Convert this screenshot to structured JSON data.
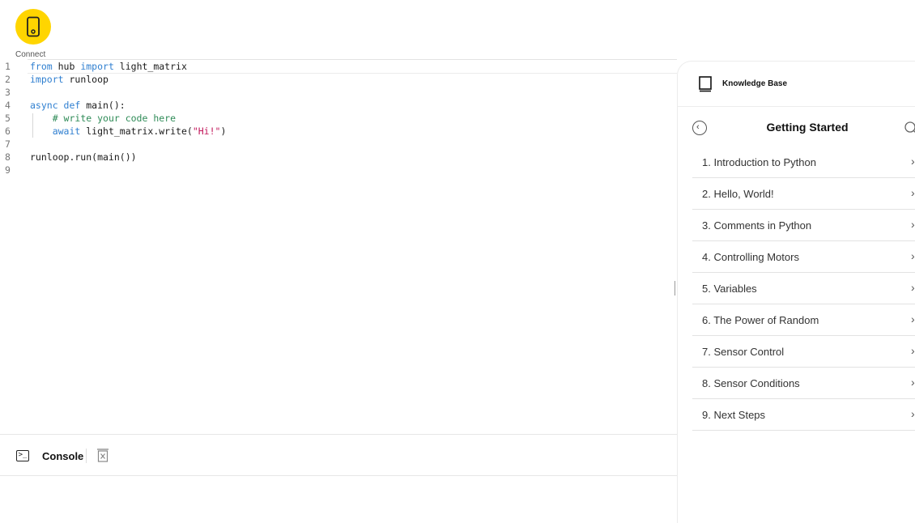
{
  "connect": {
    "label": "Connect",
    "icon": "hub-icon",
    "color": "#ffd500"
  },
  "editor": {
    "lines": [
      {
        "n": "1",
        "parts": [
          {
            "t": "from",
            "c": "kw"
          },
          {
            "t": " hub ",
            "c": ""
          },
          {
            "t": "import",
            "c": "kw"
          },
          {
            "t": " light_matrix",
            "c": ""
          }
        ]
      },
      {
        "n": "2",
        "parts": [
          {
            "t": "import",
            "c": "kw"
          },
          {
            "t": " runloop",
            "c": ""
          }
        ]
      },
      {
        "n": "3",
        "parts": []
      },
      {
        "n": "4",
        "parts": [
          {
            "t": "async def",
            "c": "kw"
          },
          {
            "t": " main():",
            "c": ""
          }
        ]
      },
      {
        "n": "5",
        "parts": [
          {
            "t": "    ",
            "c": ""
          },
          {
            "t": "# write your code here",
            "c": "cm"
          }
        ]
      },
      {
        "n": "6",
        "parts": [
          {
            "t": "    ",
            "c": ""
          },
          {
            "t": "await",
            "c": "kw"
          },
          {
            "t": " light_matrix.write(",
            "c": ""
          },
          {
            "t": "\"Hi!\"",
            "c": "str"
          },
          {
            "t": ")",
            "c": ""
          }
        ]
      },
      {
        "n": "7",
        "parts": []
      },
      {
        "n": "8",
        "parts": [
          {
            "t": "runloop.run(main())",
            "c": ""
          }
        ]
      },
      {
        "n": "9",
        "parts": []
      }
    ]
  },
  "console": {
    "label": "Console",
    "icon": "terminal-icon",
    "clear_icon": "clear-console-icon"
  },
  "knowledge_base": {
    "title": "Knowledge Base",
    "section": "Getting Started",
    "items": [
      "1. Introduction to Python",
      "2. Hello, World!",
      "3. Comments in Python",
      "4. Controlling Motors",
      "5. Variables",
      "6. The Power of Random",
      "7. Sensor Control",
      "8. Sensor Conditions",
      "9. Next Steps"
    ]
  }
}
